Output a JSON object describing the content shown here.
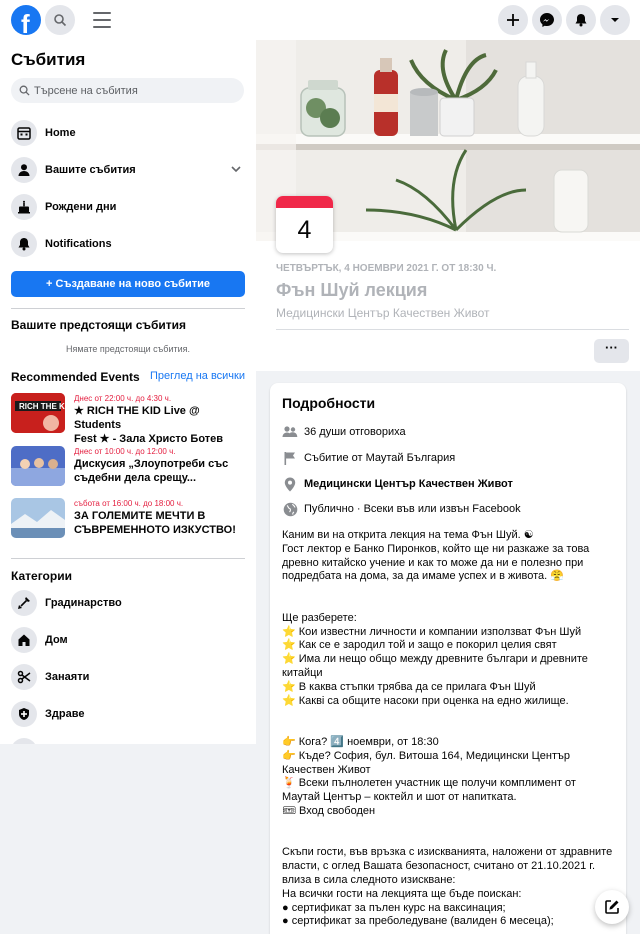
{
  "topbar": {
    "logo": "facebook-logo",
    "icons": [
      "search-icon",
      "menu-icon",
      "plus-icon",
      "messenger-icon",
      "notifications-icon",
      "account-dropdown-icon"
    ]
  },
  "sidebar": {
    "title": "Събития",
    "search_placeholder": "Търсене на събития",
    "nav": [
      {
        "label": "Home",
        "icon": "calendar-home-icon"
      },
      {
        "label": "Вашите събития",
        "icon": "person-icon"
      },
      {
        "label": "Рождени дни",
        "icon": "cake-icon"
      },
      {
        "label": "Notifications",
        "icon": "bell-icon"
      }
    ],
    "create_label": "+ Създаване на ново събитие",
    "upcoming_title": "Вашите предстоящи събития",
    "upcoming_empty": "Нямате предстоящи събития.",
    "recommended_title": "Recommended Events",
    "see_all": "Преглед на всички",
    "recommended": [
      {
        "when": "Днес от 22:00 ч. до 4:30 ч.",
        "name_line1": "★ RICH THE KID Live @ Students",
        "name_line2": "Fest ★ - Зала Христо Ботев"
      },
      {
        "when": "Днес от 10:00 ч. до 12:00 ч.",
        "name_line1": "Дискусия „Злоупотреби със",
        "name_line2": "съдебни дела срещу..."
      },
      {
        "when": "събота от 16:00 ч. до 18:00 ч.",
        "name_line1": "ЗА ГОЛЕМИТЕ МЕЧТИ В",
        "name_line2": "СЪВРЕМЕННОТО ИЗКУСТВО!"
      }
    ],
    "categories_title": "Категории",
    "categories": [
      {
        "label": "Градинарство",
        "icon": "shovel-icon"
      },
      {
        "label": "Дом",
        "icon": "house-icon"
      },
      {
        "label": "Занаяти",
        "icon": "scissors-icon"
      },
      {
        "label": "Здраве",
        "icon": "health-plus-icon"
      }
    ]
  },
  "event": {
    "day": "4",
    "date_line": "ЧЕТВЪРТЪК, 4 НОЕМВРИ 2021 Г. ОТ 18:30 Ч.",
    "title": "Фън Шуй лекция",
    "place": "Медицински Център Качествен Живот",
    "more": "···"
  },
  "details": {
    "title": "Подробности",
    "rows": [
      {
        "text": "36 души отговориха",
        "icon": "people-icon",
        "bold": false
      },
      {
        "text": "Събитие от Маутай България",
        "icon": "flag-icon",
        "bold": false
      },
      {
        "text": "Медицински Център Качествен Живот",
        "icon": "location-pin-icon",
        "bold": true
      },
      {
        "text": "Публично · Всеки във или извън Facebook",
        "icon": "globe-icon",
        "bold": false
      }
    ],
    "description": "Каним ви на открита лекция на тема Фън Шуй. ☯\nГост лектор е Банко Пиронков, който ще ни разкаже за това древно китайско учение и как то може да ни е полезно при подредбата на дома, за да имаме успех и в живота. 😤\n\n\nЩе разберете:\n⭐ Кои известни личности и компании използват Фън Шуй\n⭐ Как се е зародил той и защо е покорил целия свят\n⭐ Има ли нещо общо между древните българи и древните китайци\n⭐ В каква стъпки трябва да се прилага Фън Шуй\n⭐ Каквi са общите насоки при оценка на едно жилище.\n\n\n👉 Кога? 4️⃣ ноември, от 18:30\n👉 Къде? София, бул. Витоша 164, Медицински Център Качествен Живот\n🍹 Всеки пълнолетен участник ще получи комплимент от Маутай Център – коктейл и шот от напитката.\n🎟 Вход свободен\n\n\nСкъпи гости, във връзка с изискванията, наложени от здравните власти, с оглед Вашата безопасност, считано от 21.10.2021 г. влиза в сила следното изискване:\nНа всички гости на лекцията ще бъде поискан:\n● сертификат за пълен курс на ваксинация;\n● сертификат за преболедуване (валиден 6 месеца);"
  },
  "colors": {
    "brand": "#1877f2",
    "date_red": "#f02849",
    "muted": "#b0b3b8"
  }
}
